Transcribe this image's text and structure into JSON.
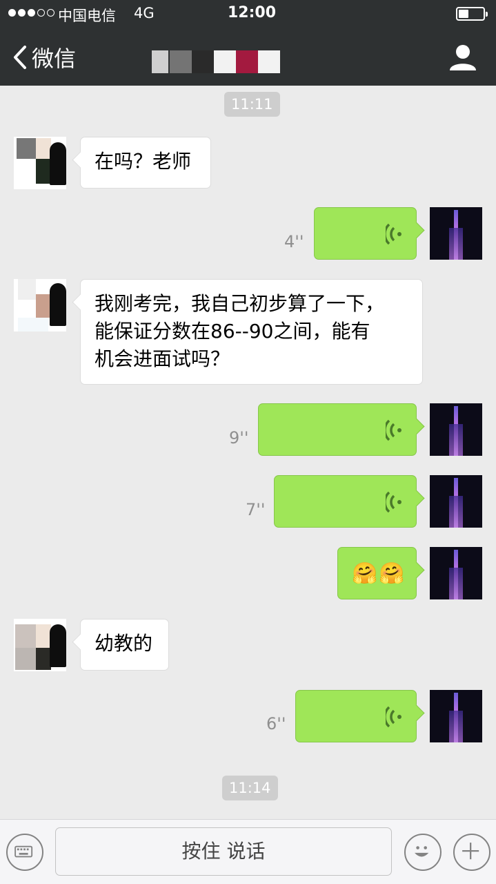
{
  "status_bar": {
    "carrier": "中国电信",
    "network": "4G",
    "time": "12:00"
  },
  "nav": {
    "back_label": "微信",
    "back_icon": "chevron-left-icon",
    "profile_icon": "person-icon"
  },
  "chat": {
    "timestamps": [
      "11:11",
      "11:14"
    ],
    "messages": [
      {
        "side": "left",
        "type": "text",
        "text": "在吗？老师"
      },
      {
        "side": "right",
        "type": "voice",
        "duration": "4''"
      },
      {
        "side": "left",
        "type": "text",
        "lines": [
          "我刚考完，我自己初步算了一下，",
          "能保证分数在86--90之间，能有",
          "机会进面试吗？"
        ]
      },
      {
        "side": "right",
        "type": "voice",
        "duration": "9''"
      },
      {
        "side": "right",
        "type": "voice",
        "duration": "7''"
      },
      {
        "side": "right",
        "type": "emoji",
        "text": "🤗🤗"
      },
      {
        "side": "left",
        "type": "text",
        "text": "幼教的"
      },
      {
        "side": "right",
        "type": "voice",
        "duration": "6''"
      }
    ]
  },
  "input_bar": {
    "hold_to_talk": "按住 说话",
    "keyboard_icon": "keyboard-icon",
    "emoji_icon": "smiley-icon",
    "add_icon": "plus-icon"
  },
  "colors": {
    "nav_bg": "#2e3132",
    "chat_bg": "#ebebeb",
    "my_bubble": "#9fe658",
    "their_bubble": "#ffffff"
  }
}
